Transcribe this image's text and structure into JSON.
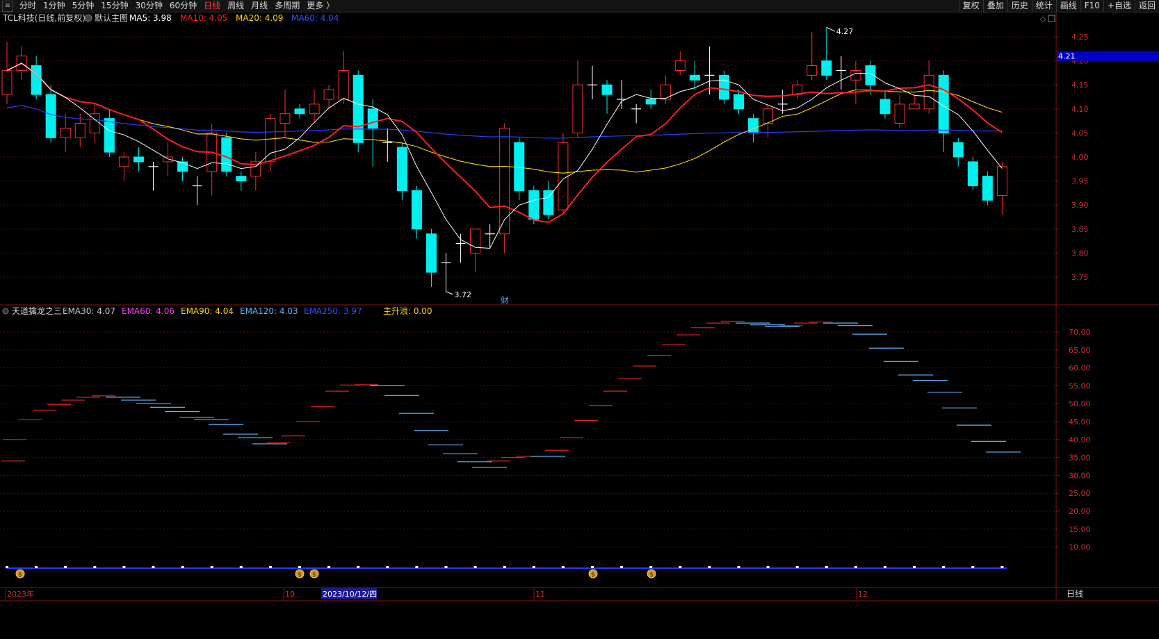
{
  "toolbar": {
    "left": [
      "分时",
      "1分钟",
      "5分钟",
      "15分钟",
      "30分钟",
      "60分钟",
      "日线",
      "周线",
      "月线",
      "多周期",
      "更多 〉"
    ],
    "active": "日线",
    "right": [
      "复权",
      "叠加",
      "历史",
      "统计",
      "画线",
      "F10",
      "+自选",
      "返回"
    ]
  },
  "main": {
    "title": "TCL科技(日线,前复权)",
    "subtitle": "默认主图",
    "legend": [
      {
        "label": "MA5: 3.98",
        "color": "#ffffff"
      },
      {
        "label": "MA10: 4.05",
        "color": "#ff2020"
      },
      {
        "label": "MA20: 4.09",
        "color": "#ffd700"
      },
      {
        "label": "MA60: 4.04",
        "color": "#3050ff"
      }
    ],
    "price_axis": [
      "4.25",
      "4.20",
      "4.15",
      "4.10",
      "4.05",
      "4.00",
      "3.95",
      "3.90",
      "3.85",
      "3.80",
      "3.75"
    ],
    "current_price": "4.21",
    "high_label": "4.27",
    "low_label": "3.72",
    "event_marker": "财"
  },
  "indicator": {
    "title": "天道擒龙之三",
    "legend": [
      {
        "label": "EMA30: 4.07",
        "color": "#c8c8c8"
      },
      {
        "label": "EMA60: 4.06",
        "color": "#ff40ff"
      },
      {
        "label": "EMA90: 4.04",
        "color": "#ffd700"
      },
      {
        "label": "EMA120: 4.03",
        "color": "#5fb6ff"
      },
      {
        "label": "EMA250: 3.97",
        "color": "#3050ff"
      },
      {
        "label": "主升浪: 0.00",
        "color": "#ffd700"
      }
    ],
    "axis": [
      "70.00",
      "65.00",
      "60.00",
      "55.00",
      "50.00",
      "45.00",
      "40.00",
      "35.00",
      "30.00",
      "25.00",
      "20.00",
      "15.00",
      "10.00"
    ]
  },
  "bottom_axis": {
    "labels": [
      "2023年",
      "10",
      "2023/10/12/四",
      "11",
      "12"
    ],
    "period": "日线"
  },
  "colors": {
    "up": "#ff3030",
    "down": "#00f0f0",
    "ma5": "#ffffff",
    "ma10": "#ff2020",
    "ma20": "#ffd700",
    "ma60": "#2040ff"
  },
  "chart_data": {
    "type": "candlestick",
    "y_range": [
      3.7,
      4.28
    ],
    "candles": [
      [
        4.13,
        4.18,
        4.24,
        4.11
      ],
      [
        4.18,
        4.21,
        4.23,
        4.16
      ],
      [
        4.19,
        4.13,
        4.21,
        4.12
      ],
      [
        4.13,
        4.04,
        4.15,
        4.03
      ],
      [
        4.04,
        4.06,
        4.09,
        4.01
      ],
      [
        4.04,
        4.07,
        4.09,
        4.02
      ],
      [
        4.05,
        4.09,
        4.11,
        4.03
      ],
      [
        4.08,
        4.01,
        4.1,
        4.0
      ],
      [
        3.98,
        4.0,
        4.01,
        3.95
      ],
      [
        4.0,
        3.99,
        4.02,
        3.97
      ],
      [
        3.98,
        3.98,
        3.99,
        3.93
      ],
      [
        3.99,
        4.0,
        4.03,
        3.96
      ],
      [
        3.99,
        3.97,
        4.0,
        3.95
      ],
      [
        3.94,
        3.94,
        3.96,
        3.9
      ],
      [
        3.97,
        4.05,
        4.07,
        3.92
      ],
      [
        4.04,
        3.97,
        4.05,
        3.96
      ],
      [
        3.96,
        3.95,
        3.97,
        3.93
      ],
      [
        3.96,
        3.99,
        4.01,
        3.93
      ],
      [
        3.99,
        4.08,
        4.09,
        3.97
      ],
      [
        4.07,
        4.09,
        4.14,
        4.04
      ],
      [
        4.1,
        4.09,
        4.11,
        4.08
      ],
      [
        4.09,
        4.11,
        4.14,
        4.07
      ],
      [
        4.12,
        4.14,
        4.15,
        4.1
      ],
      [
        4.12,
        4.18,
        4.22,
        4.11
      ],
      [
        4.17,
        4.03,
        4.18,
        4.01
      ],
      [
        4.1,
        4.06,
        4.12,
        3.98
      ],
      [
        4.03,
        4.03,
        4.06,
        3.99
      ],
      [
        4.02,
        3.93,
        4.03,
        3.91
      ],
      [
        3.93,
        3.85,
        3.94,
        3.83
      ],
      [
        3.84,
        3.76,
        3.85,
        3.73
      ],
      [
        3.78,
        3.78,
        3.8,
        3.72
      ],
      [
        3.82,
        3.82,
        3.84,
        3.78
      ],
      [
        3.8,
        3.85,
        3.85,
        3.76
      ],
      [
        3.84,
        3.84,
        3.86,
        3.81
      ],
      [
        3.84,
        4.06,
        4.07,
        3.8
      ],
      [
        4.03,
        3.93,
        4.04,
        3.91
      ],
      [
        3.93,
        3.87,
        3.94,
        3.86
      ],
      [
        3.93,
        3.88,
        3.95,
        3.87
      ],
      [
        3.89,
        4.03,
        4.05,
        3.88
      ],
      [
        4.05,
        4.15,
        4.2,
        4.04
      ],
      [
        4.15,
        4.15,
        4.19,
        4.12
      ],
      [
        4.15,
        4.13,
        4.16,
        4.09
      ],
      [
        4.12,
        4.12,
        4.16,
        4.1
      ],
      [
        4.1,
        4.1,
        4.11,
        4.07
      ],
      [
        4.12,
        4.11,
        4.14,
        4.1
      ],
      [
        4.12,
        4.15,
        4.17,
        4.11
      ],
      [
        4.18,
        4.2,
        4.22,
        4.17
      ],
      [
        4.17,
        4.16,
        4.2,
        4.14
      ],
      [
        4.17,
        4.17,
        4.23,
        4.13
      ],
      [
        4.17,
        4.12,
        4.18,
        4.11
      ],
      [
        4.13,
        4.1,
        4.14,
        4.09
      ],
      [
        4.08,
        4.05,
        4.09,
        4.03
      ],
      [
        4.07,
        4.1,
        4.11,
        4.04
      ],
      [
        4.11,
        4.11,
        4.14,
        4.09
      ],
      [
        4.13,
        4.15,
        4.16,
        4.12
      ],
      [
        4.17,
        4.19,
        4.26,
        4.16
      ],
      [
        4.2,
        4.17,
        4.27,
        4.16
      ],
      [
        4.18,
        4.18,
        4.21,
        4.14
      ],
      [
        4.16,
        4.18,
        4.2,
        4.11
      ],
      [
        4.19,
        4.15,
        4.2,
        4.13
      ],
      [
        4.12,
        4.09,
        4.14,
        4.08
      ],
      [
        4.07,
        4.11,
        4.13,
        4.06
      ],
      [
        4.1,
        4.11,
        4.13,
        4.1
      ],
      [
        4.1,
        4.17,
        4.2,
        4.09
      ],
      [
        4.17,
        4.05,
        4.18,
        4.01
      ],
      [
        4.03,
        4.0,
        4.04,
        3.98
      ],
      [
        3.99,
        3.94,
        4.0,
        3.93
      ],
      [
        3.96,
        3.91,
        3.97,
        3.9
      ],
      [
        3.92,
        3.98,
        3.99,
        3.88
      ]
    ]
  }
}
